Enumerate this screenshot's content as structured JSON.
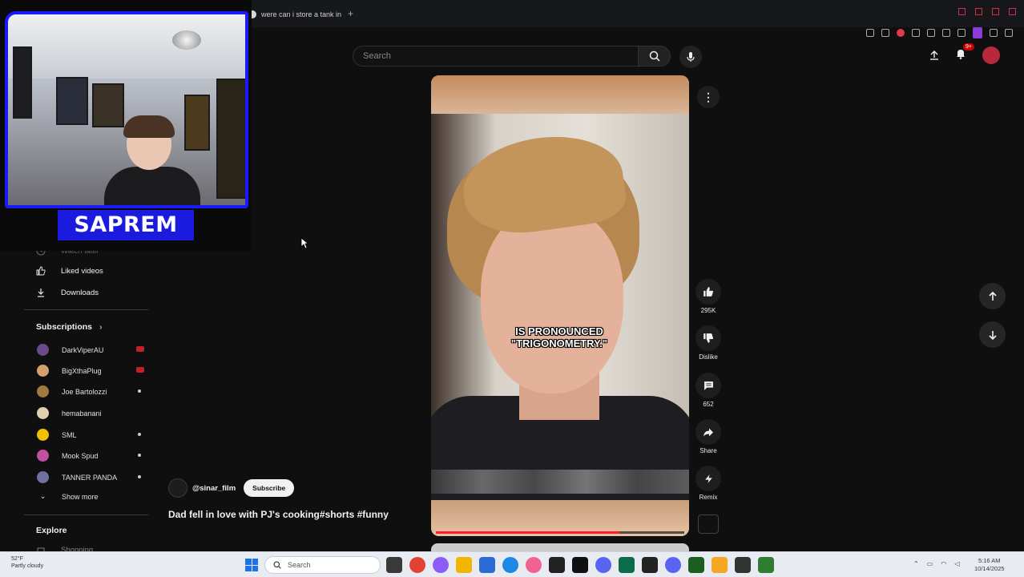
{
  "browser": {
    "tab_title": "were can i store a tank in",
    "tab_add": "+"
  },
  "youtube": {
    "search_placeholder": "Search",
    "notification_count": "9+"
  },
  "webcam": {
    "streamer_name": "SAPREM",
    "frame_color": "#1a1aff"
  },
  "sidebar": {
    "partial_item": "Watch later",
    "items": [
      {
        "label": "Liked videos",
        "icon": "thumbs-up-icon"
      },
      {
        "label": "Downloads",
        "icon": "download-icon"
      }
    ],
    "subscriptions_heading": "Subscriptions",
    "subscriptions": [
      {
        "name": "DarkViperAU",
        "color": "#6b4a8a",
        "status": "live"
      },
      {
        "name": "BigXthaPlug",
        "color": "#d4a070",
        "status": "live"
      },
      {
        "name": "Joe Bartolozzi",
        "color": "#a07a40",
        "status": "dot"
      },
      {
        "name": "hemabanani",
        "color": "#e0d0b0",
        "status": "none"
      },
      {
        "name": "SML",
        "color": "#f2c200",
        "status": "dot"
      },
      {
        "name": "Mook Spud",
        "color": "#c050a0",
        "status": "dot"
      },
      {
        "name": "TANNER PANDA",
        "color": "#7070a0",
        "status": "dot"
      }
    ],
    "show_more": "Show more",
    "explore_heading": "Explore",
    "partial_explore_item": "Shopping"
  },
  "short": {
    "caption_line1": "IS PRONOUNCED",
    "caption_line2": "\"TRIGONOMETRY.\"",
    "progress_fraction": 0.74,
    "channel": "@sinar_film",
    "subscribe": "Subscribe",
    "title": "Dad fell in love with PJ's cooking#shorts #funny",
    "likes": "295K",
    "dislike": "Dislike",
    "comments": "652",
    "share": "Share",
    "remix": "Remix"
  },
  "taskbar": {
    "weather_line1": "52°F",
    "weather_line2": "Partly cloudy",
    "search": "Search",
    "time": "5:16 AM",
    "date": "10/14/2025"
  }
}
